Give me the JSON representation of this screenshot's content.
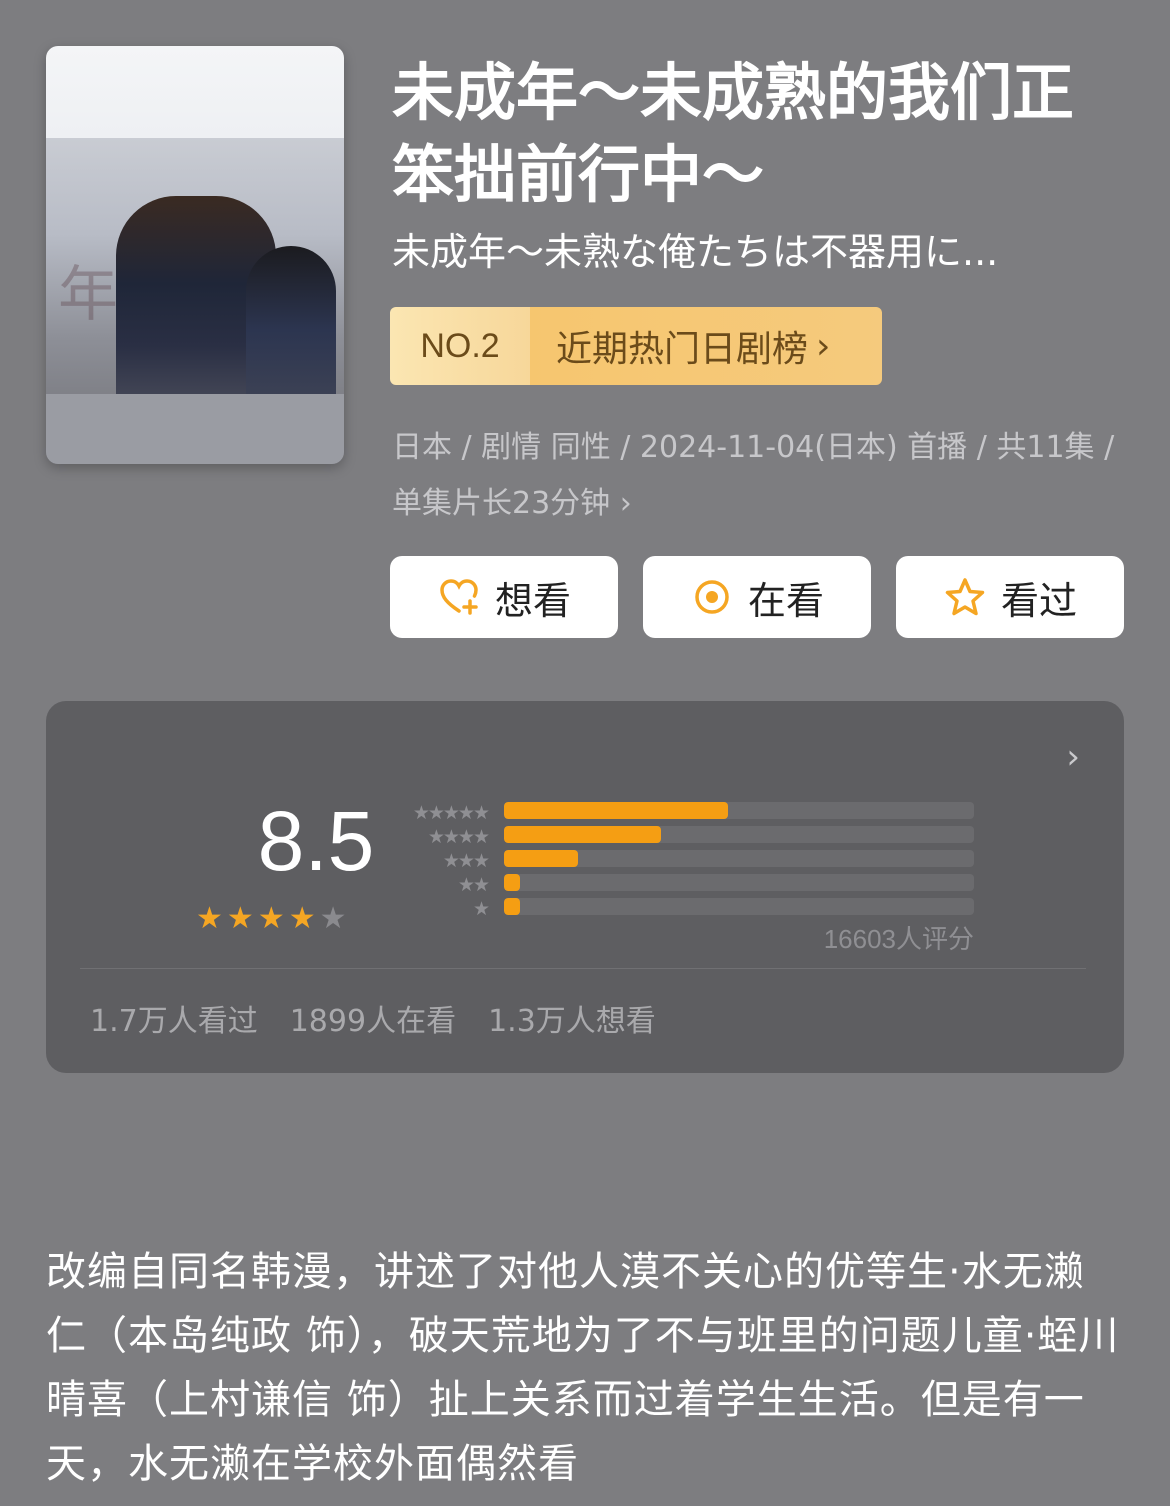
{
  "title": "未成年～未成熟的我们正笨拙前行中～",
  "original_title": "未成年～未熟な俺たちは不器用に...",
  "rank": {
    "number": "NO.2",
    "list_name": "近期热门日剧榜"
  },
  "meta_text": "日本 / 剧情 同性 / 2024-11-04(日本) 首播 / 共11集 / 单集片长23分钟",
  "actions": {
    "want_label": "想看",
    "watching_label": "在看",
    "watched_label": "看过"
  },
  "rating": {
    "score": "8.5",
    "stars_filled": 4,
    "stars_total": 5,
    "distribution_percent": [
      47.6,
      33.4,
      15.8,
      3.5,
      3.5
    ],
    "rating_count_text": "16603人评分"
  },
  "watch_stats": {
    "watched": "1.7万人看过",
    "watching": "1899人在看",
    "want": "1.3万人想看"
  },
  "description": "改编自同名韩漫，讲述了对他人漠不关心的优等生·水无濑仁（本岛纯政 饰），破天荒地为了不与班里的问题儿童·蛭川晴喜（上村谦信 饰）扯上关系而过着学生生活。但是有一天，水无濑在学校外面偶然看",
  "colors": {
    "background": "#7d7d80",
    "accent_orange": "#f59e13",
    "card": "#5e5e61"
  }
}
